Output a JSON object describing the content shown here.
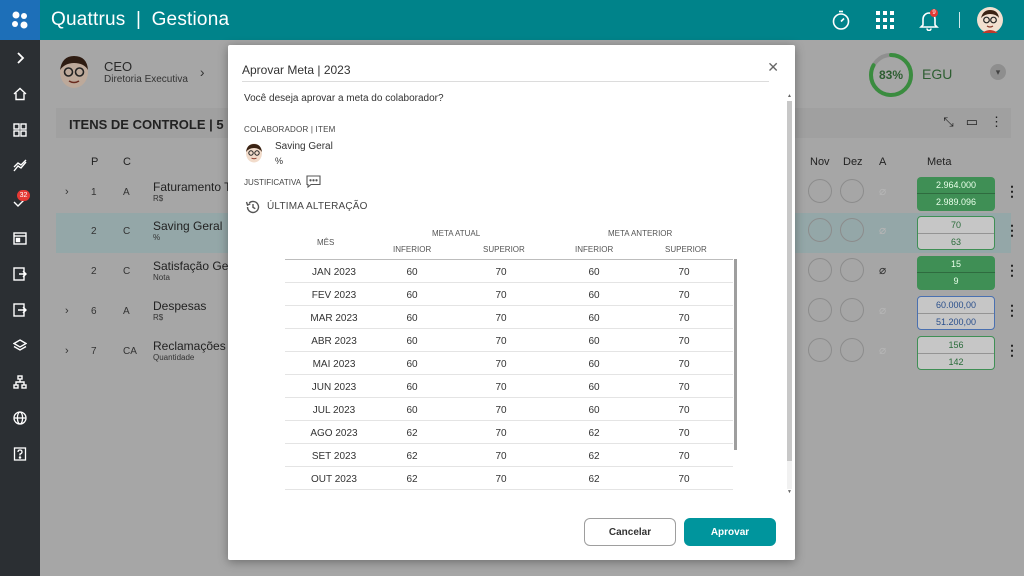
{
  "app": {
    "name": "Quattrus",
    "module": "Gestiona",
    "separator": "|"
  },
  "topbar": {
    "notification_count": "9"
  },
  "sidebar": {
    "badge": "32"
  },
  "page": {
    "profile_role": "CEO",
    "profile_dept": "Diretoria Executiva",
    "score": "83%",
    "score_label": "EGU",
    "card_title": "ITENS DE CONTROLE | 5",
    "columns": {
      "p": "P",
      "c": "C",
      "nov": "Nov",
      "dez": "Dez",
      "a": "A",
      "meta": "Meta"
    },
    "rows": [
      {
        "p": "1",
        "c": "A",
        "name": "Faturamento To",
        "unit": "R$",
        "meta1": "2.964.000",
        "meta2": "2.989.096",
        "style": "green"
      },
      {
        "p": "2",
        "c": "C",
        "name": "Saving Geral",
        "unit": "%",
        "meta1": "70",
        "meta2": "63",
        "style": "outline-green"
      },
      {
        "p": "2",
        "c": "C",
        "name": "Satisfação Gera",
        "unit": "Nota",
        "meta1": "15",
        "meta2": "9",
        "style": "green"
      },
      {
        "p": "6",
        "c": "A",
        "name": "Despesas",
        "unit": "R$",
        "meta1": "60.000,00",
        "meta2": "51.200,00",
        "style": "outline-blue"
      },
      {
        "p": "7",
        "c": "CA",
        "name": "Reclamações c",
        "unit": "Quantidade",
        "meta1": "156",
        "meta2": "142",
        "style": "outline-green"
      }
    ]
  },
  "modal": {
    "title": "Aprovar Meta | 2023",
    "question": "Você deseja aprovar a meta do colaborador?",
    "colab_label": "COLABORADOR | ITEM",
    "colab_name": "Saving Geral",
    "colab_unit": "%",
    "justificativa_label": "JUSTIFICATIVA",
    "history_label": "ÚLTIMA ALTERAÇÃO",
    "table": {
      "col_month": "MÊS",
      "group_current": "META ATUAL",
      "group_previous": "META ANTERIOR",
      "sub_inferior": "INFERIOR",
      "sub_superior": "SUPERIOR",
      "rows": [
        {
          "month": "JAN 2023",
          "cur_inf": "60",
          "cur_sup": "70",
          "prev_inf": "60",
          "prev_sup": "70"
        },
        {
          "month": "FEV 2023",
          "cur_inf": "60",
          "cur_sup": "70",
          "prev_inf": "60",
          "prev_sup": "70"
        },
        {
          "month": "MAR 2023",
          "cur_inf": "60",
          "cur_sup": "70",
          "prev_inf": "60",
          "prev_sup": "70"
        },
        {
          "month": "ABR 2023",
          "cur_inf": "60",
          "cur_sup": "70",
          "prev_inf": "60",
          "prev_sup": "70"
        },
        {
          "month": "MAI 2023",
          "cur_inf": "60",
          "cur_sup": "70",
          "prev_inf": "60",
          "prev_sup": "70"
        },
        {
          "month": "JUN 2023",
          "cur_inf": "60",
          "cur_sup": "70",
          "prev_inf": "60",
          "prev_sup": "70"
        },
        {
          "month": "JUL 2023",
          "cur_inf": "60",
          "cur_sup": "70",
          "prev_inf": "60",
          "prev_sup": "70"
        },
        {
          "month": "AGO 2023",
          "cur_inf": "62",
          "cur_sup": "70",
          "prev_inf": "62",
          "prev_sup": "70"
        },
        {
          "month": "SET 2023",
          "cur_inf": "62",
          "cur_sup": "70",
          "prev_inf": "62",
          "prev_sup": "70"
        },
        {
          "month": "OUT 2023",
          "cur_inf": "62",
          "cur_sup": "70",
          "prev_inf": "62",
          "prev_sup": "70"
        }
      ]
    },
    "cancel_label": "Cancelar",
    "approve_label": "Aprovar"
  },
  "colors": {
    "teal": "#00838a",
    "button": "#00959d",
    "sidebar": "#2b2f33",
    "logo": "#1d6fb8"
  }
}
